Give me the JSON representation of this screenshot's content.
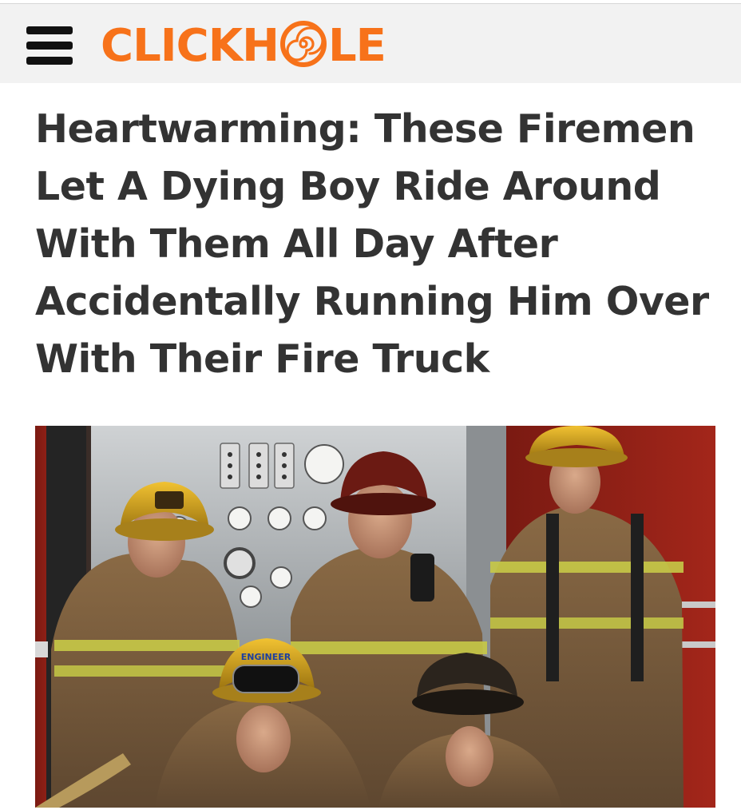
{
  "header": {
    "menu_icon": "hamburger-menu-icon",
    "logo": {
      "text_before": "CLICKH",
      "text_after": "LE",
      "full_text": "CLICKHOLE",
      "color": "#f7721a"
    }
  },
  "article": {
    "headline": "Heartwarming: These Firemen Let A Dying Boy Ride Around With Them All Day After Accidentally Running Him Over With Their Fire Truck",
    "headline_color": "#333333"
  },
  "photo": {
    "subject": "firefighters-group-photo",
    "helmet_labels": {
      "front_center": "ENGINEER"
    }
  },
  "colors": {
    "header_bg": "#f2f2f2",
    "accent": "#f7721a"
  }
}
